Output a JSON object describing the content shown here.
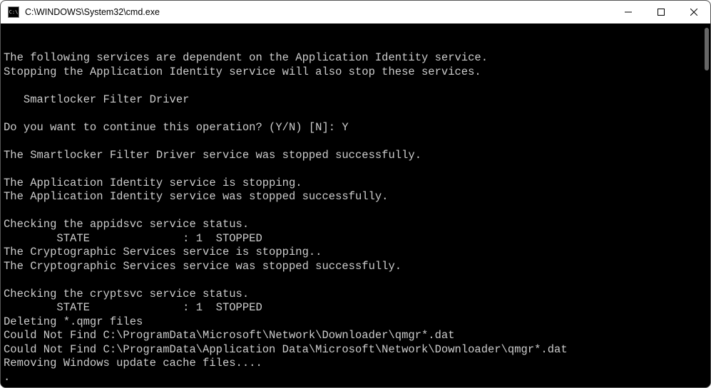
{
  "window": {
    "title": "C:\\WINDOWS\\System32\\cmd.exe"
  },
  "console": {
    "lines": [
      "The following services are dependent on the Application Identity service.",
      "Stopping the Application Identity service will also stop these services.",
      "",
      "   Smartlocker Filter Driver",
      "",
      "Do you want to continue this operation? (Y/N) [N]: Y",
      "",
      "The Smartlocker Filter Driver service was stopped successfully.",
      "",
      "The Application Identity service is stopping.",
      "The Application Identity service was stopped successfully.",
      "",
      "Checking the appidsvc service status.",
      "        STATE              : 1  STOPPED",
      "The Cryptographic Services service is stopping..",
      "The Cryptographic Services service was stopped successfully.",
      "",
      "Checking the cryptsvc service status.",
      "        STATE              : 1  STOPPED",
      "Deleting *.qmgr files",
      "Could Not Find C:\\ProgramData\\Microsoft\\Network\\Downloader\\qmgr*.dat",
      "Could Not Find C:\\ProgramData\\Application Data\\Microsoft\\Network\\Downloader\\qmgr*.dat",
      "Removing Windows update cache files....",
      "."
    ]
  }
}
